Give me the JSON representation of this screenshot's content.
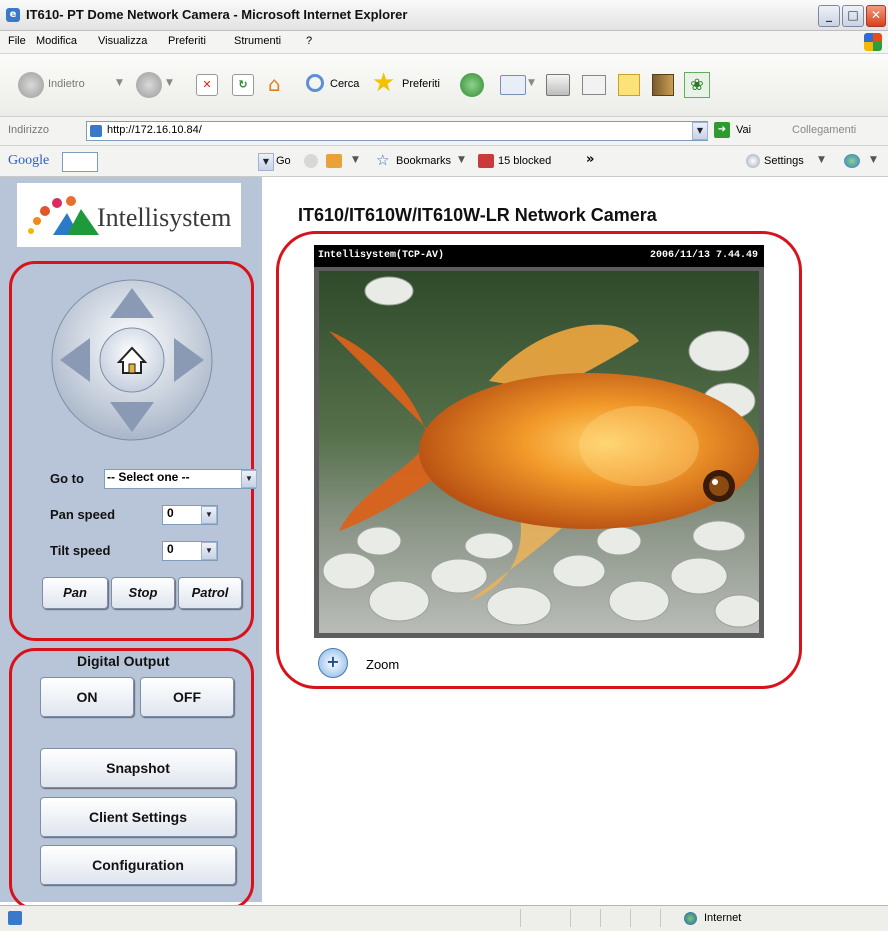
{
  "window": {
    "title": "IT610- PT Dome Network Camera - Microsoft Internet Explorer"
  },
  "menu": [
    "File",
    "Modifica",
    "Visualizza",
    "Preferiti",
    "Strumenti",
    "?"
  ],
  "toolbar": {
    "back": "Indietro",
    "search": "Cerca",
    "favorites": "Preferiti"
  },
  "address": {
    "label": "Indirizzo",
    "url": "http://172.16.10.84/",
    "go": "Vai",
    "links": "Collegamenti"
  },
  "googlebar": {
    "logo": "Google",
    "go": "Go",
    "bookmarks": "Bookmarks",
    "blocked": "15 blocked",
    "more": "»",
    "settings": "Settings"
  },
  "page": {
    "heading": "IT610/IT610W/IT610W-LR Network Camera",
    "logo_text": "Intellisystem",
    "ptz": {
      "goto_label": "Go to",
      "goto_value": "-- Select one --",
      "pan_speed_label": "Pan speed",
      "pan_speed_value": "0",
      "tilt_speed_label": "Tilt speed",
      "tilt_speed_value": "0",
      "buttons": [
        "Pan",
        "Stop",
        "Patrol"
      ]
    },
    "digital_output": {
      "label": "Digital Output",
      "on": "ON",
      "off": "OFF"
    },
    "actions": [
      "Snapshot",
      "Client Settings",
      "Configuration"
    ],
    "video": {
      "overlay_left": "Intellisystem(TCP-AV)",
      "overlay_right": "2006/11/13 7.44.49",
      "zoom_label": "Zoom"
    }
  },
  "status": {
    "zone": "Internet"
  },
  "colors": {
    "sidebar": "#b8c5d8",
    "highlight": "#d8121b"
  }
}
